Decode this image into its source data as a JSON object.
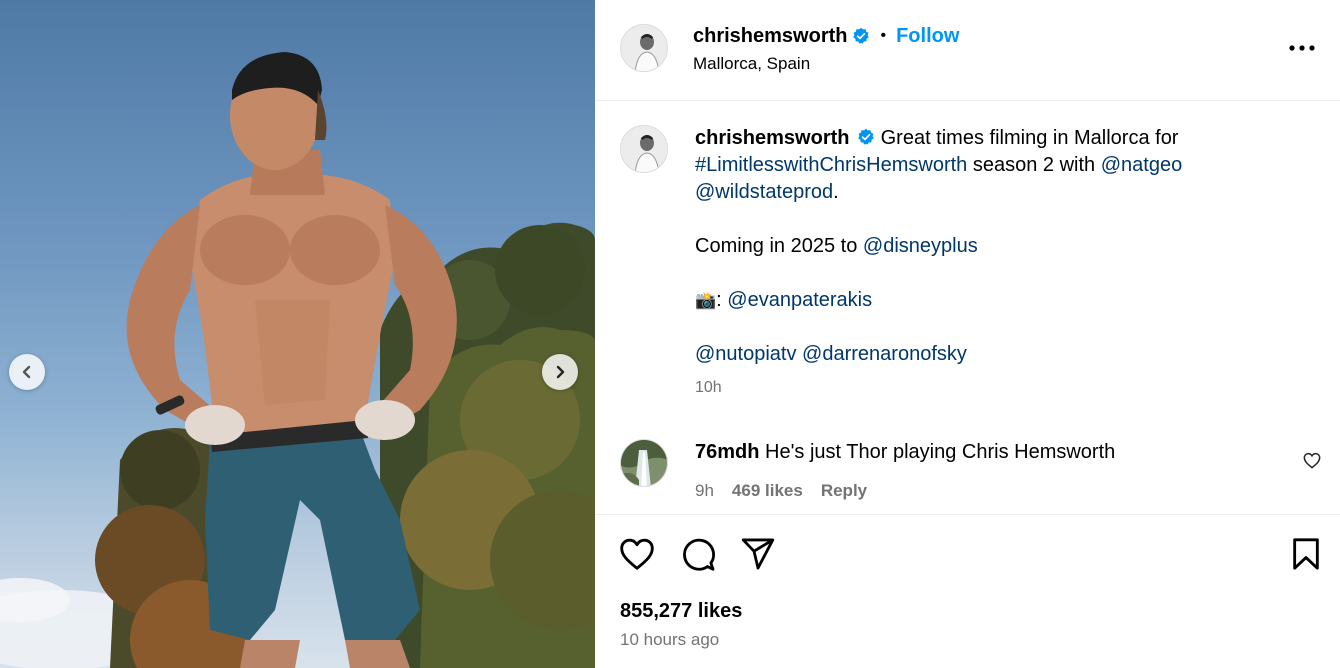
{
  "post": {
    "author": {
      "username": "chrishemsworth",
      "verified": true,
      "location": "Mallorca, Spain"
    },
    "header": {
      "separator": "•",
      "follow_label": "Follow"
    },
    "caption": {
      "username": "chrishemsworth",
      "line1_text": "Great times filming in Mallorca for",
      "hashtag": "#LimitlesswithChrisHemsworth",
      "mid_text": "season 2 with",
      "mention_natgeo": "@natgeo",
      "mention_wildstate": "@wildstateprod",
      "period": ".",
      "coming_text": "Coming in 2025 to",
      "mention_disney": "@disneyplus",
      "camera_emoji": "📸",
      "camera_colon": ":",
      "mention_evan": "@evanpaterakis",
      "mention_nutopia": "@nutopiatv",
      "mention_darren": "@darrenaronofsky",
      "time": "10h"
    },
    "comment": {
      "username": "76mdh",
      "text": "He's just Thor playing Chris Hemsworth",
      "time": "9h",
      "likes": "469 likes",
      "reply_label": "Reply"
    },
    "likes_count": "855,277 likes",
    "posted_ago": "10 hours ago"
  },
  "icons": {
    "verified": "verified-badge-icon",
    "more": "more-options-icon",
    "prev": "chevron-left-icon",
    "next": "chevron-right-icon",
    "like": "heart-icon",
    "comment": "comment-bubble-icon",
    "share": "paper-plane-icon",
    "save": "bookmark-icon"
  },
  "colors": {
    "link": "#00376b",
    "follow": "#0095f6",
    "verified": "#0095f6",
    "muted": "#737373"
  }
}
